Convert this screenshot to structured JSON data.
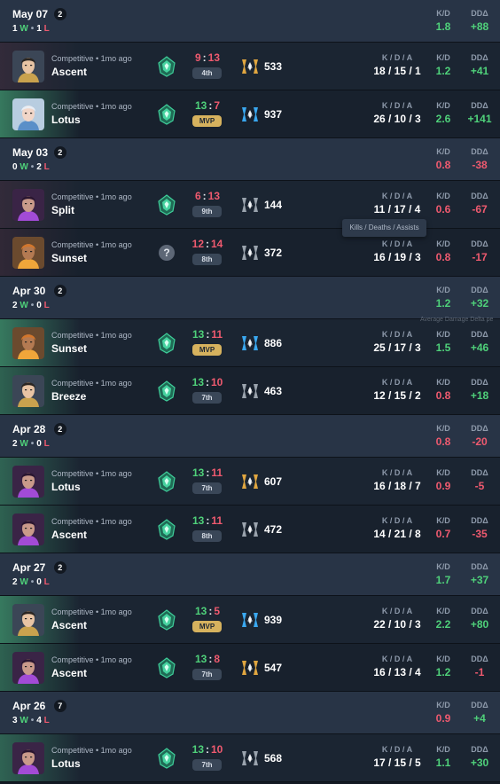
{
  "labels": {
    "kd": "K/D",
    "dd": "DDΔ",
    "kda": "K / D / A",
    "win_suffix": "W",
    "loss_suffix": "L",
    "dot": "•"
  },
  "tooltip": "Kills / Deaths / Assists",
  "tooltip_faded": "Average Damage Delta pe",
  "colors": {
    "win": "#4fd17a",
    "loss": "#ef5a6f",
    "mvp": "#d6b25e",
    "header_bg": "#283446",
    "row_bg": "#1b2532"
  },
  "days": [
    {
      "date": "May 07",
      "count": "2",
      "wins": "1",
      "losses": "1",
      "kd": "1.8",
      "kd_good": true,
      "dd": "+88",
      "dd_good": true,
      "matches": [
        {
          "mode": "Competitive • 1mo ago",
          "map": "Ascent",
          "agent": "chamber",
          "rank_icon": "ascendant-rank-icon",
          "score_us": "9",
          "score_them": "13",
          "result": "loss",
          "placement": "4th",
          "mvp": false,
          "acs_tier": "gold",
          "acs": "533",
          "kda": "18 / 15 / 1",
          "kd": "1.2",
          "kd_good": true,
          "dd": "+41",
          "dd_good": true
        },
        {
          "mode": "Competitive • 1mo ago",
          "map": "Lotus",
          "agent": "jett",
          "rank_icon": "ascendant-rank-icon",
          "score_us": "13",
          "score_them": "7",
          "result": "win",
          "placement": "MVP",
          "mvp": true,
          "acs_tier": "blue",
          "acs": "937",
          "kda": "26 / 10 / 3",
          "kd": "2.6",
          "kd_good": true,
          "dd": "+141",
          "dd_good": true
        }
      ]
    },
    {
      "date": "May 03",
      "count": "2",
      "wins": "0",
      "losses": "2",
      "kd": "0.8",
      "kd_good": false,
      "dd": "-38",
      "dd_good": false,
      "matches": [
        {
          "mode": "Competitive • 1mo ago",
          "map": "Split",
          "agent": "reyna",
          "rank_icon": "ascendant-rank-icon",
          "score_us": "6",
          "score_them": "13",
          "result": "loss",
          "placement": "9th",
          "mvp": false,
          "acs_tier": "silver",
          "acs": "144",
          "kda": "11 / 17 / 4",
          "kd": "0.6",
          "kd_good": false,
          "dd": "-67",
          "dd_good": false
        },
        {
          "mode": "Competitive • 1mo ago",
          "map": "Sunset",
          "agent": "raze",
          "rank_icon": "unknown-rank-icon",
          "score_us": "12",
          "score_them": "14",
          "result": "loss",
          "placement": "8th",
          "mvp": false,
          "acs_tier": "silver",
          "acs": "372",
          "kda": "16 / 19 / 3",
          "kd": "0.8",
          "kd_good": false,
          "dd": "-17",
          "dd_good": false
        }
      ]
    },
    {
      "date": "Apr 30",
      "count": "2",
      "wins": "2",
      "losses": "0",
      "kd": "1.2",
      "kd_good": true,
      "dd": "+32",
      "dd_good": true,
      "matches": [
        {
          "mode": "Competitive • 1mo ago",
          "map": "Sunset",
          "agent": "raze",
          "rank_icon": "ascendant-rank-icon",
          "score_us": "13",
          "score_them": "11",
          "result": "win",
          "placement": "MVP",
          "mvp": true,
          "acs_tier": "blue",
          "acs": "886",
          "kda": "25 / 17 / 3",
          "kd": "1.5",
          "kd_good": true,
          "dd": "+46",
          "dd_good": true
        },
        {
          "mode": "Competitive • 1mo ago",
          "map": "Breeze",
          "agent": "chamber",
          "rank_icon": "ascendant-rank-icon",
          "score_us": "13",
          "score_them": "10",
          "result": "win",
          "placement": "7th",
          "mvp": false,
          "acs_tier": "silver",
          "acs": "463",
          "kda": "12 / 15 / 2",
          "kd": "0.8",
          "kd_good": false,
          "dd": "+18",
          "dd_good": true
        }
      ]
    },
    {
      "date": "Apr 28",
      "count": "2",
      "wins": "2",
      "losses": "0",
      "kd": "0.8",
      "kd_good": false,
      "dd": "-20",
      "dd_good": false,
      "matches": [
        {
          "mode": "Competitive • 1mo ago",
          "map": "Lotus",
          "agent": "reyna",
          "rank_icon": "ascendant-rank-icon",
          "score_us": "13",
          "score_them": "11",
          "result": "win",
          "placement": "7th",
          "mvp": false,
          "acs_tier": "gold",
          "acs": "607",
          "kda": "16 / 18 / 7",
          "kd": "0.9",
          "kd_good": false,
          "dd": "-5",
          "dd_good": false
        },
        {
          "mode": "Competitive • 1mo ago",
          "map": "Ascent",
          "agent": "reyna",
          "rank_icon": "ascendant-rank-icon",
          "score_us": "13",
          "score_them": "11",
          "result": "win",
          "placement": "8th",
          "mvp": false,
          "acs_tier": "silver",
          "acs": "472",
          "kda": "14 / 21 / 8",
          "kd": "0.7",
          "kd_good": false,
          "dd": "-35",
          "dd_good": false
        }
      ]
    },
    {
      "date": "Apr 27",
      "count": "2",
      "wins": "2",
      "losses": "0",
      "kd": "1.7",
      "kd_good": true,
      "dd": "+37",
      "dd_good": true,
      "matches": [
        {
          "mode": "Competitive • 1mo ago",
          "map": "Ascent",
          "agent": "chamber",
          "rank_icon": "ascendant-rank-icon",
          "score_us": "13",
          "score_them": "5",
          "result": "win",
          "placement": "MVP",
          "mvp": true,
          "acs_tier": "blue",
          "acs": "939",
          "kda": "22 / 10 / 3",
          "kd": "2.2",
          "kd_good": true,
          "dd": "+80",
          "dd_good": true
        },
        {
          "mode": "Competitive • 1mo ago",
          "map": "Ascent",
          "agent": "reyna",
          "rank_icon": "ascendant-rank-icon",
          "score_us": "13",
          "score_them": "8",
          "result": "win",
          "placement": "7th",
          "mvp": false,
          "acs_tier": "gold",
          "acs": "547",
          "kda": "16 / 13 / 4",
          "kd": "1.2",
          "kd_good": true,
          "dd": "-1",
          "dd_good": false
        }
      ]
    },
    {
      "date": "Apr 26",
      "count": "7",
      "wins": "3",
      "losses": "4",
      "kd": "0.9",
      "kd_good": false,
      "dd": "+4",
      "dd_good": true,
      "matches": [
        {
          "mode": "Competitive • 1mo ago",
          "map": "Lotus",
          "agent": "reyna",
          "rank_icon": "ascendant-rank-icon",
          "score_us": "13",
          "score_them": "10",
          "result": "win",
          "placement": "7th",
          "mvp": false,
          "acs_tier": "silver",
          "acs": "568",
          "kda": "17 / 15 / 5",
          "kd": "1.1",
          "kd_good": true,
          "dd": "+30",
          "dd_good": true
        }
      ]
    }
  ]
}
